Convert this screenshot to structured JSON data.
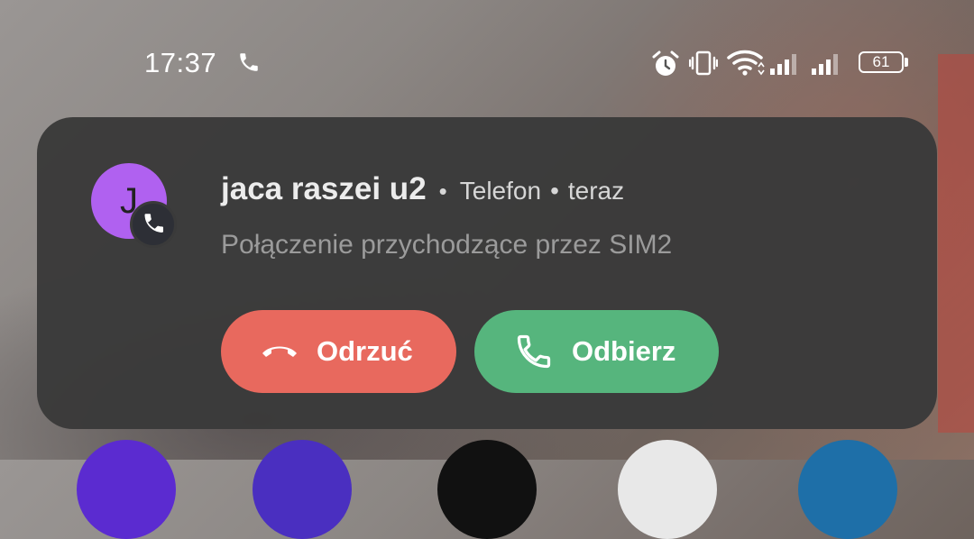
{
  "status_bar": {
    "time": "17:37",
    "icons": [
      "phone-icon",
      "alarm-icon",
      "vibrate-icon",
      "wifi-icon",
      "signal-sim1-icon",
      "signal-sim2-icon",
      "battery-icon"
    ],
    "battery_level": "61"
  },
  "notification": {
    "avatar_letter": "J",
    "avatar_color": "#b061f0",
    "caller_name": "jaca raszei u2",
    "separator": "•",
    "app_name": "Telefon",
    "time_separator": "•",
    "time": "teraz",
    "message": "Połączenie przychodzące przez SIM2",
    "decline_label": "Odrzuć",
    "accept_label": "Odbierz",
    "decline_color": "#e8695e",
    "accept_color": "#56b57d"
  },
  "dock_apps": [
    "#5b2bd0",
    "#4a2fc0",
    "#111111",
    "#e8e8e8",
    "#1e6fa8"
  ]
}
